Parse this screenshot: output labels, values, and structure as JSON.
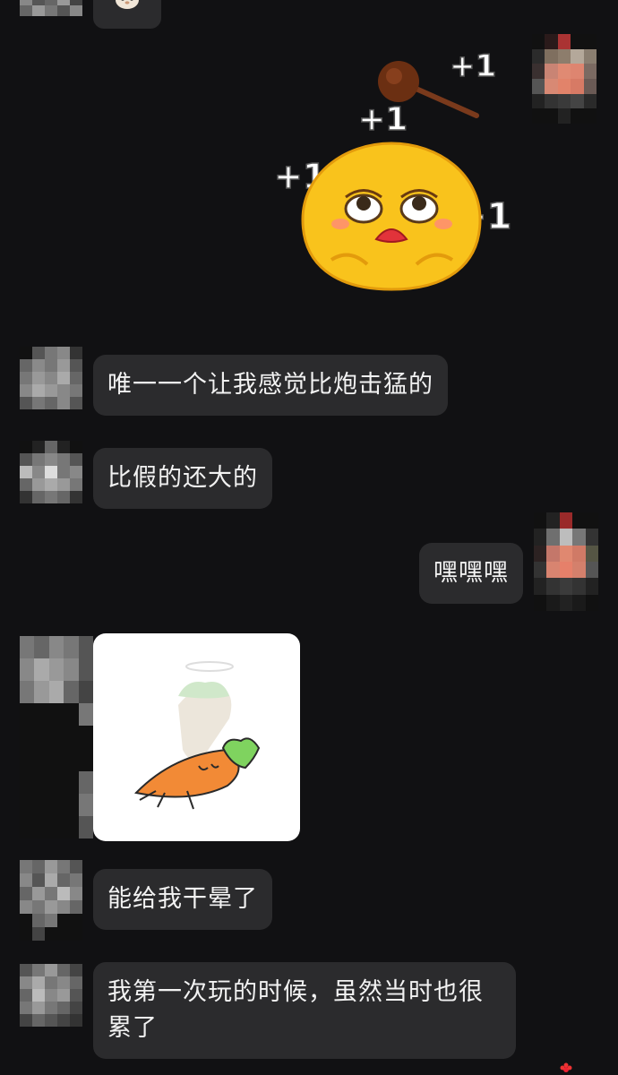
{
  "messages": [
    {
      "side": "left",
      "kind": "text",
      "text": "唯一一个让我感觉比炮击猛的"
    },
    {
      "side": "left",
      "kind": "text",
      "text": "比假的还大的"
    },
    {
      "side": "right",
      "kind": "text",
      "text": "嘿嘿嘿"
    },
    {
      "side": "left",
      "kind": "sticker",
      "sticker": "carrot-sticker"
    },
    {
      "side": "left",
      "kind": "text",
      "text": "能给我干晕了"
    },
    {
      "side": "left",
      "kind": "text",
      "text": "我第一次玩的时候，虽然当时也很累了"
    }
  ],
  "emoji_sticker": {
    "name": "emoji-knocked-plus-one",
    "plus_one_text": "+1"
  },
  "colors": {
    "background": "#111113",
    "bubble": "#2b2b2d",
    "text": "#f2f2f2"
  }
}
